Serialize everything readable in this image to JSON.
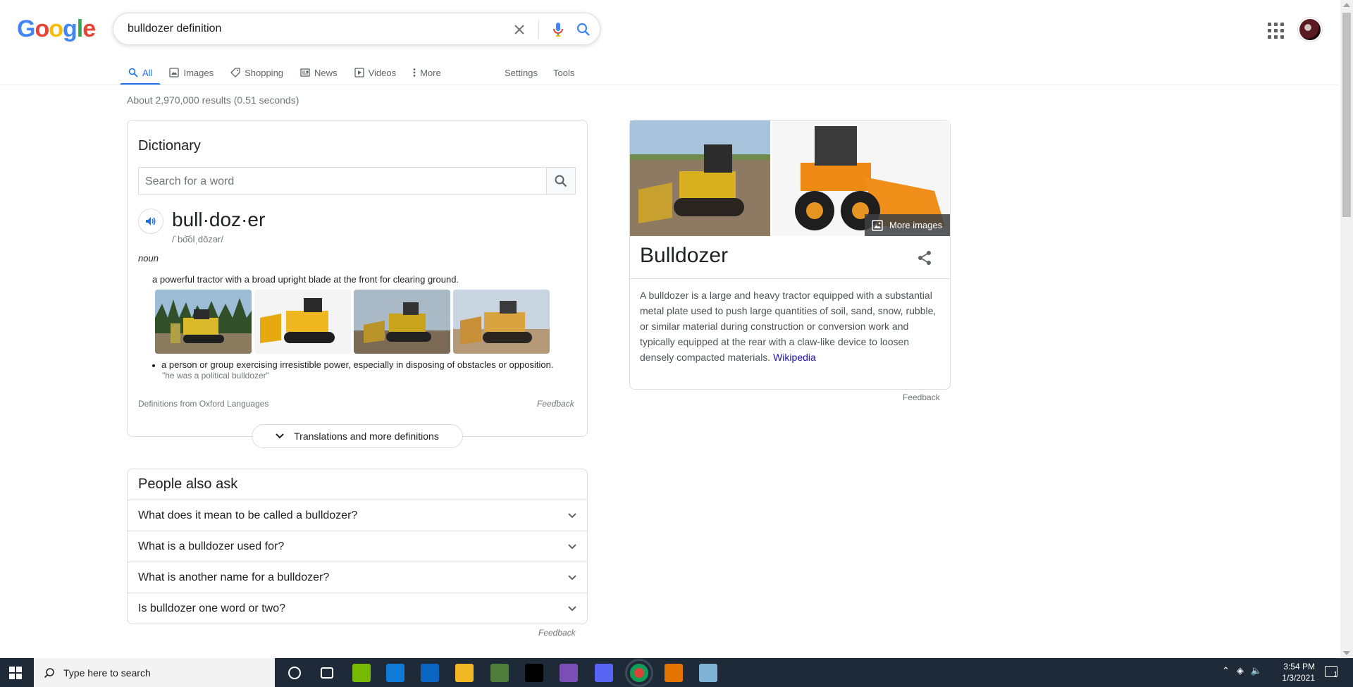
{
  "header": {
    "logo_letters": [
      {
        "ch": "G",
        "color": "#4285F4"
      },
      {
        "ch": "o",
        "color": "#EA4335"
      },
      {
        "ch": "o",
        "color": "#FBBC05"
      },
      {
        "ch": "g",
        "color": "#4285F4"
      },
      {
        "ch": "l",
        "color": "#34A853"
      },
      {
        "ch": "e",
        "color": "#EA4335"
      }
    ],
    "query": "bulldozer definition"
  },
  "tabs": [
    {
      "label": "All",
      "icon": "search-icon",
      "active": true
    },
    {
      "label": "Images",
      "icon": "image-icon"
    },
    {
      "label": "Shopping",
      "icon": "tag-icon"
    },
    {
      "label": "News",
      "icon": "news-icon"
    },
    {
      "label": "Videos",
      "icon": "play-icon"
    },
    {
      "label": "More",
      "icon": "kebab-icon"
    }
  ],
  "tabs_right": [
    "Settings",
    "Tools"
  ],
  "stats": "About 2,970,000 results (0.51 seconds)",
  "dictionary": {
    "title": "Dictionary",
    "search_placeholder": "Search for a word",
    "word": "bull·doz·er",
    "phonetic": "/ˈbo͝olˌdōzər/",
    "pos": "noun",
    "def1": "a powerful tractor with a broad upright blade at the front for clearing ground.",
    "def2": "a person or group exercising irresistible power, especially in disposing of obstacles or opposition.",
    "example": "\"he was a political bulldozer\"",
    "source": "Definitions from Oxford Languages",
    "feedback": "Feedback",
    "more_button": "Translations and more definitions"
  },
  "paa": {
    "title": "People also ask",
    "questions": [
      "What does it mean to be called a bulldozer?",
      "What is a bulldozer used for?",
      "What is another name for a bulldozer?",
      "Is bulldozer one word or two?"
    ],
    "feedback": "Feedback"
  },
  "knowledge_panel": {
    "more_images": "More images",
    "title": "Bulldozer",
    "description": "A bulldozer is a large and heavy tractor equipped with a substantial metal plate used to push large quantities of soil, sand, snow, rubble, or similar material during construction or conversion work and typically equipped at the rear with a claw-like device to loosen densely compacted materials.",
    "source_link": "Wikipedia",
    "feedback": "Feedback"
  },
  "taskbar": {
    "search_placeholder": "Type here to search",
    "time": "3:54 PM",
    "date": "1/3/2021",
    "notification_count": "1",
    "apps": [
      {
        "name": "cortana-icon",
        "color": "#1f2a38"
      },
      {
        "name": "task-view-icon",
        "color": "#1f2a38"
      },
      {
        "name": "nvidia-icon",
        "color": "#76b900"
      },
      {
        "name": "edge-icon",
        "color": "#0f7bd6"
      },
      {
        "name": "mail-icon",
        "color": "#0a64c2"
      },
      {
        "name": "file-explorer-icon",
        "color": "#f2b824"
      },
      {
        "name": "app-icon",
        "color": "#4c7d3a"
      },
      {
        "name": "netflix-icon",
        "color": "#000000"
      },
      {
        "name": "winrar-icon",
        "color": "#7a4fb5"
      },
      {
        "name": "discord-icon",
        "color": "#5865f2"
      },
      {
        "name": "chrome-icon",
        "color": "#db4437"
      },
      {
        "name": "slides-icon",
        "color": "#e37400"
      },
      {
        "name": "notepad-icon",
        "color": "#7fb3d5"
      }
    ]
  }
}
